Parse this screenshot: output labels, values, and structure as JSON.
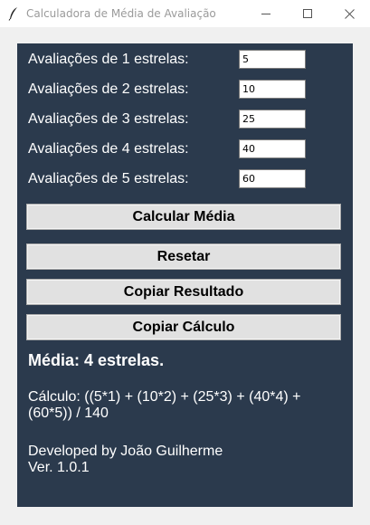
{
  "window": {
    "title": "Calculadora de Média de Avaliação"
  },
  "ratings": [
    {
      "label": "Avaliações de 1 estrelas:",
      "value": "5"
    },
    {
      "label": "Avaliações de 2 estrelas:",
      "value": "10"
    },
    {
      "label": "Avaliações de 3 estrelas:",
      "value": "25"
    },
    {
      "label": "Avaliações de 4 estrelas:",
      "value": "40"
    },
    {
      "label": "Avaliações de 5 estrelas:",
      "value": "60"
    }
  ],
  "buttons": {
    "calcular": "Calcular Média",
    "resetar": "Resetar",
    "copiar_resultado": "Copiar Resultado",
    "copiar_calculo": "Copiar Cálculo"
  },
  "result": {
    "media": "Média: 4 estrelas.",
    "calculo": "Cálculo: ((5*1) + (10*2) + (25*3) + (40*4) + (60*5)) / 140"
  },
  "footer": {
    "developer": "Developed by João Guilherme",
    "version": "Ver. 1.0.1"
  },
  "colors": {
    "panel_bg": "#2b3a4d",
    "window_bg": "#f0f0f0",
    "button_bg": "#e1e1e1",
    "text_light": "#ffffff"
  },
  "icons": {
    "app": "feather-icon",
    "minimize": "minimize-icon",
    "maximize": "maximize-icon",
    "close": "close-icon"
  }
}
